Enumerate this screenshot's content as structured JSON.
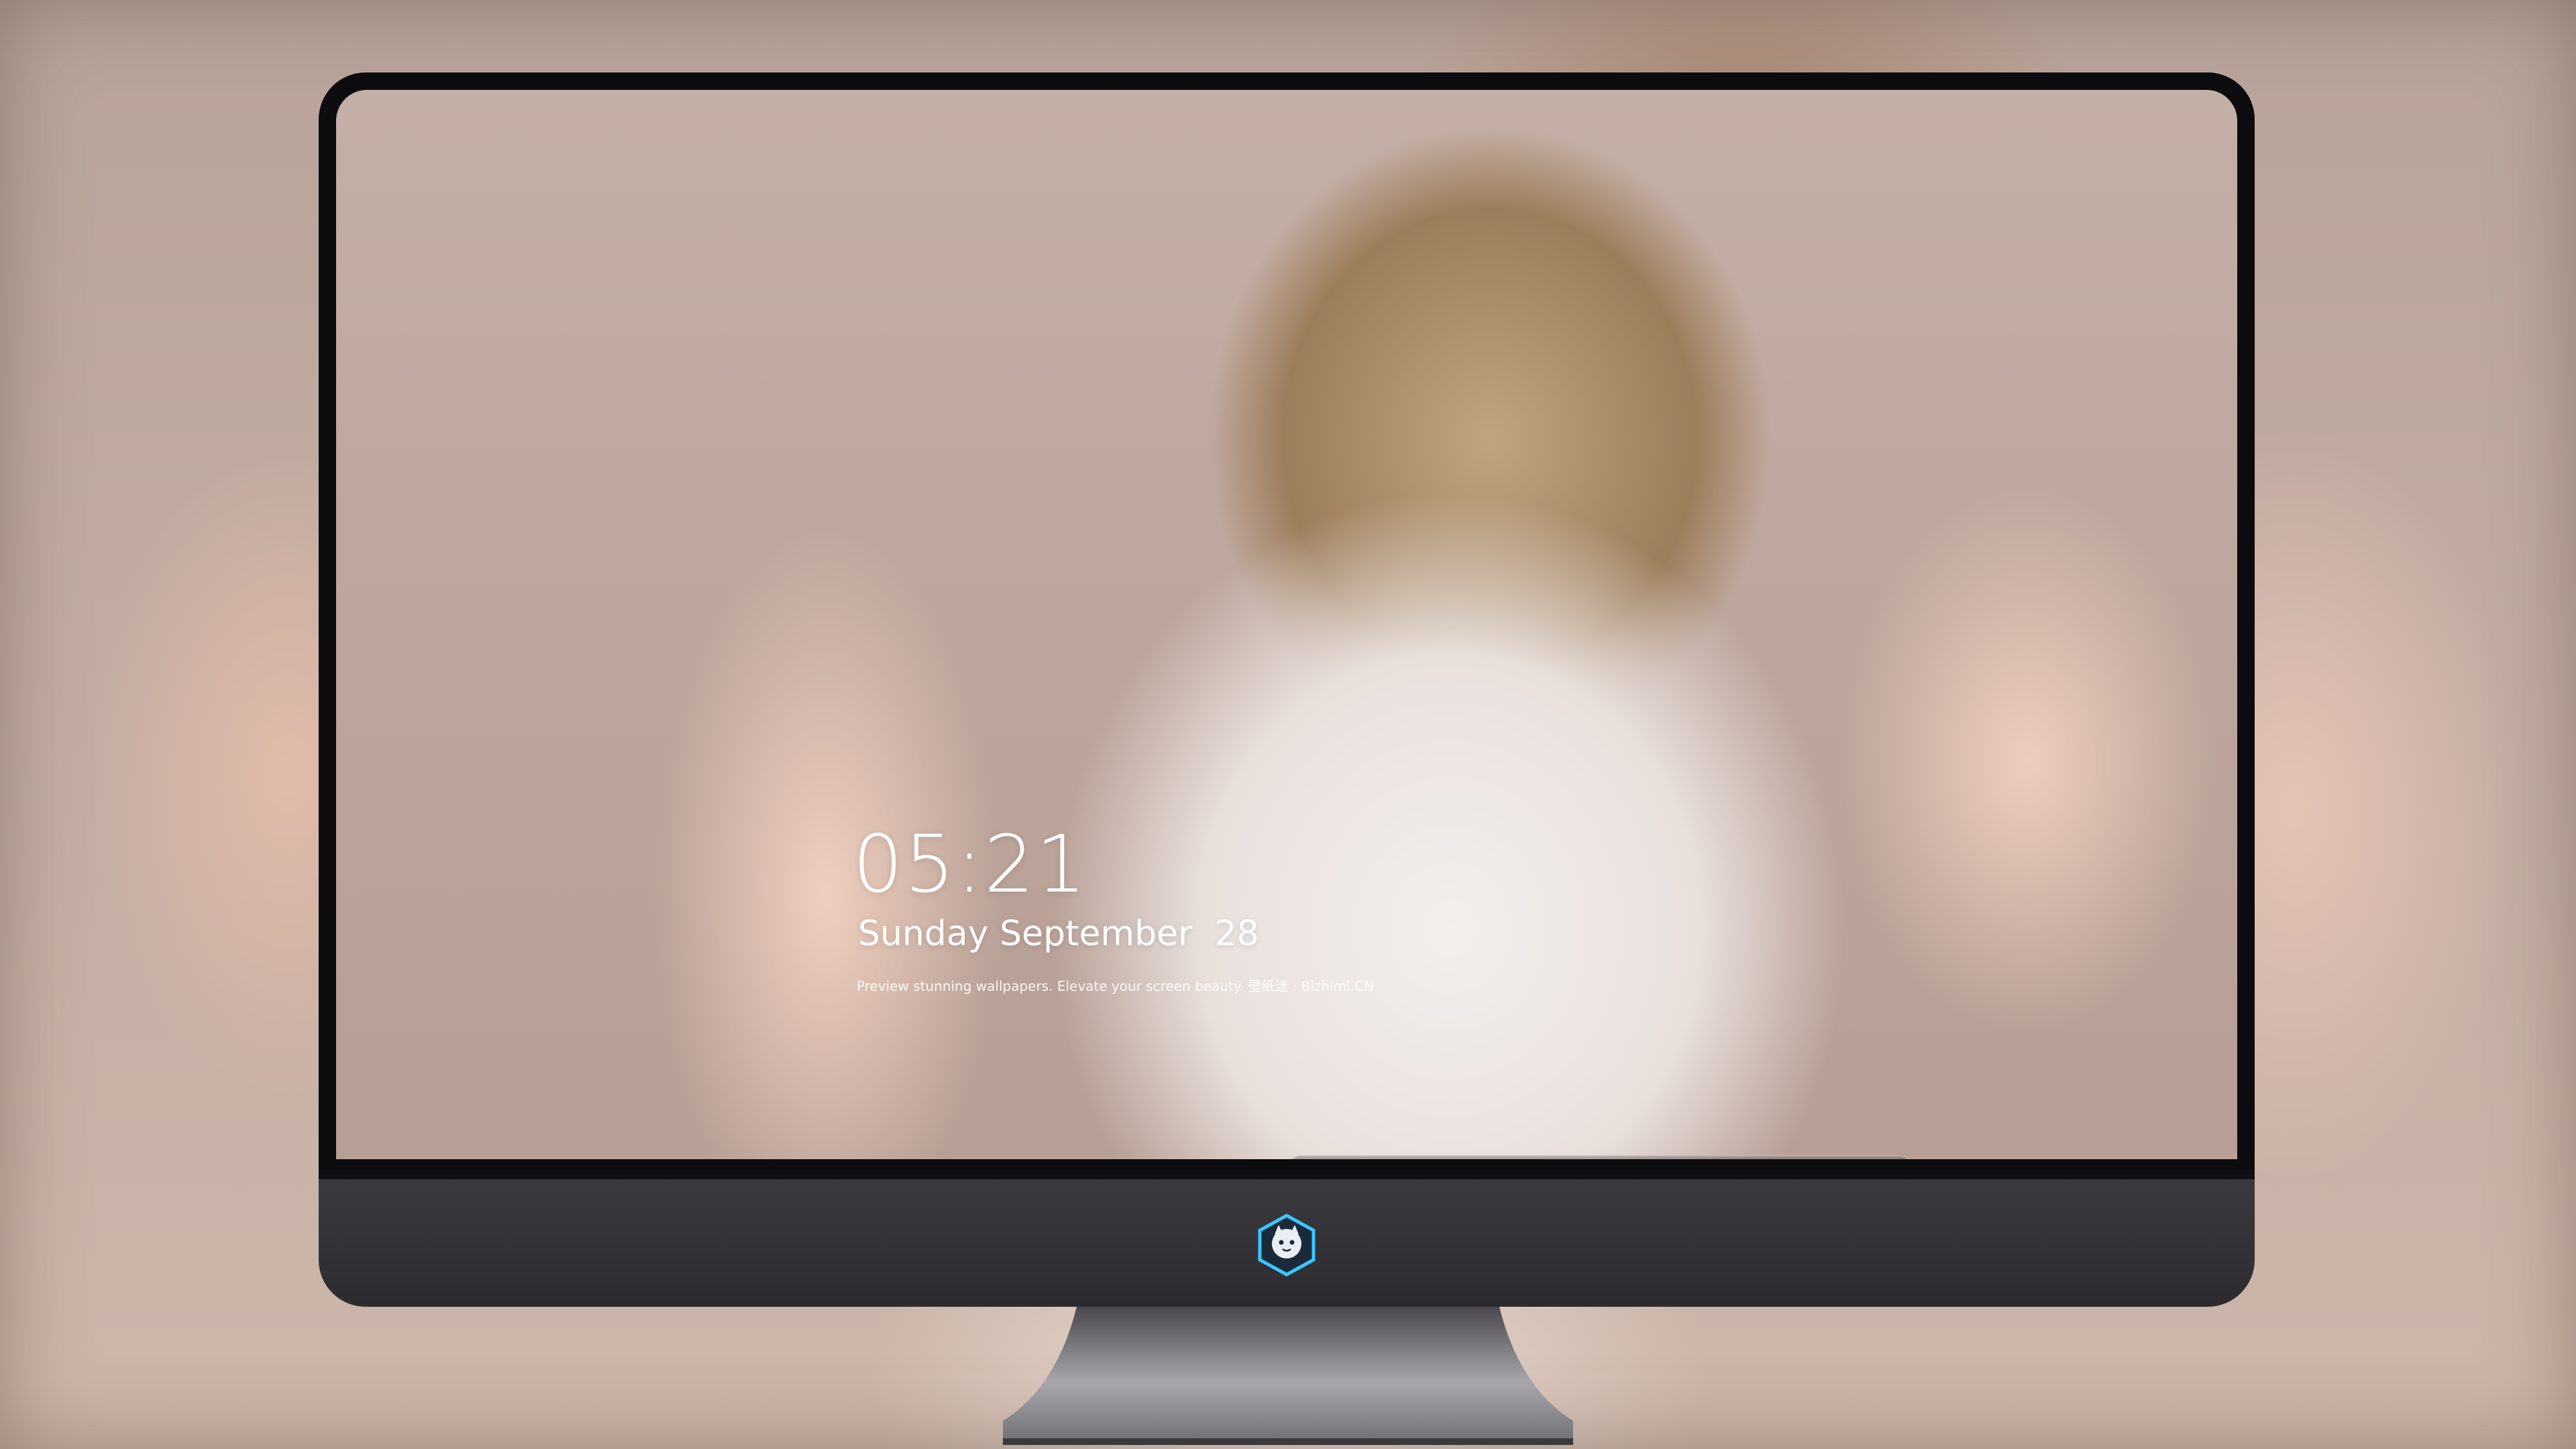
{
  "lock_screen": {
    "time": "05:21",
    "date": "Sunday September  28",
    "tagline": "Preview stunning wallpapers. Elevate your screen beauty. 壁纸迷 · Bizhimi.CN"
  },
  "dock": {
    "apps": [
      {
        "name": "messages-icon",
        "color": "#3ecf4f"
      },
      {
        "name": "weather-icon",
        "color": "#2f8df3"
      },
      {
        "name": "clock-icon",
        "color": "#111111"
      },
      {
        "name": "preview-icon",
        "color": "#e8c64a"
      },
      {
        "name": "video-editor-icon",
        "color": "#39c3ea"
      },
      {
        "name": "notes-icon",
        "color": "#f7d54a"
      },
      {
        "name": "photo-gallery-icon",
        "color": "#f4f0e8"
      },
      {
        "name": "music-icon",
        "color": "#d84ff0"
      },
      {
        "name": "app-store-icon",
        "color": "#1e8cf0"
      },
      {
        "name": "camera-icon",
        "color": "#6b6b6b"
      }
    ]
  }
}
